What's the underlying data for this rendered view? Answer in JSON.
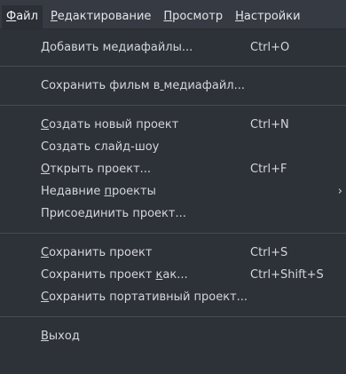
{
  "menubar": {
    "items": [
      {
        "label": "Файл",
        "hotkey_index": 0
      },
      {
        "label": "Редактирование",
        "hotkey_index": 0
      },
      {
        "label": "Просмотр",
        "hotkey_index": 0
      },
      {
        "label": "Настройки",
        "hotkey_index": 0
      }
    ],
    "active_index": 0
  },
  "file_menu": {
    "groups": [
      [
        {
          "label": "Добавить медиафайлы...",
          "hotkey_index": 0,
          "shortcut": "Ctrl+O"
        }
      ],
      [
        {
          "label": "Сохранить фильм в медиафайл...",
          "hotkey_index": 17,
          "shortcut": ""
        }
      ],
      [
        {
          "label": "Создать новый проект",
          "hotkey_index": 0,
          "shortcut": "Ctrl+N"
        },
        {
          "label": "Создать слайд-шоу",
          "hotkey_index": -1,
          "shortcut": ""
        },
        {
          "label": "Открыть проект...",
          "hotkey_index": 0,
          "shortcut": "Ctrl+F"
        },
        {
          "label": "Недавние проекты",
          "hotkey_index": 9,
          "shortcut": "",
          "submenu": true
        },
        {
          "label": "Присоединить проект...",
          "hotkey_index": -1,
          "shortcut": ""
        }
      ],
      [
        {
          "label": "Сохранить проект",
          "hotkey_index": 0,
          "shortcut": "Ctrl+S"
        },
        {
          "label": "Сохранить проект как...",
          "hotkey_index": 17,
          "shortcut": "Ctrl+Shift+S"
        },
        {
          "label": "Сохранить портативный проект...",
          "hotkey_index": 0,
          "shortcut": ""
        }
      ],
      [
        {
          "label": "Выход",
          "hotkey_index": 0,
          "shortcut": ""
        }
      ]
    ]
  },
  "icons": {
    "submenu_arrow": "chevron-right-icon"
  },
  "colors": {
    "menubar_bg": "#363a42",
    "menu_bg": "#2d3138",
    "separator": "#464b54",
    "text": "#d3d6db"
  }
}
